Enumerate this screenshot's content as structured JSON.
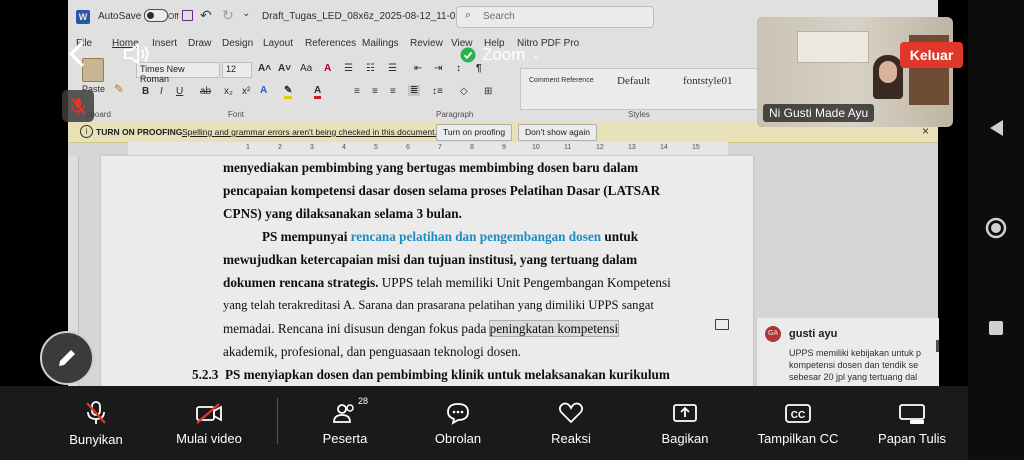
{
  "word": {
    "autosave_label": "AutoSave",
    "autosave_state": "Off",
    "doc_title": "Draft_Tugas_LED_08x6z_2025-08-12_11-0...",
    "search_placeholder": "Search",
    "tabs": [
      "File",
      "Home",
      "Insert",
      "Draw",
      "Design",
      "Layout",
      "References",
      "Mailings",
      "Review",
      "View",
      "Help",
      "Nitro PDF Pro"
    ],
    "paste_label": "Paste",
    "clipboard_label": "pboard",
    "font_name": "Times New Roman",
    "font_size": "12",
    "font_group_label": "Font",
    "paragraph_group_label": "Paragraph",
    "styles_group_label": "Styles",
    "styles": [
      "Comment Reference",
      "Default",
      "fontstyle01"
    ],
    "proofing_bar": {
      "title": "TURN ON PROOFING",
      "message": "Spelling and grammar errors aren't being checked in this document.",
      "turn_on_label": "Turn on proofing",
      "dont_show_label": "Don't show again"
    },
    "ruler_numbers": [
      "1",
      "2",
      "3",
      "4",
      "5",
      "6",
      "7",
      "8",
      "9",
      "10",
      "11",
      "12",
      "13",
      "14",
      "15"
    ],
    "document": {
      "line1": "menyediakan pembimbing yang bertugas membimbing dosen baru dalam",
      "line2": "pencapaian kompetensi dasar dosen selama proses Pelatihan Dasar (LATSAR",
      "line3": "CPNS) yang dilaksanakan selama 3 bulan.",
      "line4_a": "PS mempunyai ",
      "line4_b": "rencana pelatihan dan pengembangan dosen",
      "line4_c": " untuk",
      "line5": "mewujudkan ketercapaian misi dan tujuan institusi, yang tertuang dalam",
      "line6_a": "dokumen rencana strategis.",
      "line6_b": " UPPS telah memiliki Unit Pengembangan Kompetensi",
      "line7": "yang telah terakreditasi A. Sarana dan prasarana pelatihan yang dimiliki UPPS sangat",
      "line8_a": "memadai. Rencana ini disusun dengan fokus pada ",
      "line8_b": "peningkatan kompetensi",
      "line9": "akademik, profesional, dan penguasaan teknologi dosen.",
      "heading_num": "5.2.3",
      "heading_text": "PS menyiapkan dosen dan pembimbing klinik untuk melaksanakan kurikulum"
    },
    "comment": {
      "avatar_initials": "GA",
      "author": "gusti ayu",
      "text_lines": [
        "UPPS memiliki kebijakan untuk p",
        "kompetensi dosen dan tendik se",
        "sebesar 20 jpl yang tertuang dal"
      ]
    }
  },
  "zoom": {
    "title": "Zoom",
    "leave_label": "Keluar",
    "participant_name": "Ni Gusti Made Ayu",
    "toolbar": {
      "mute_label": "Bunyikan",
      "video_label": "Mulai video",
      "participants_label": "Peserta",
      "participants_count": "28",
      "chat_label": "Obrolan",
      "reactions_label": "Reaksi",
      "share_label": "Bagikan",
      "cc_label": "Tampilkan CC",
      "whiteboard_label": "Papan Tulis"
    },
    "colors": {
      "leave": "#e0372a",
      "secure": "#2bb24c",
      "muted": "#e0372a"
    }
  }
}
